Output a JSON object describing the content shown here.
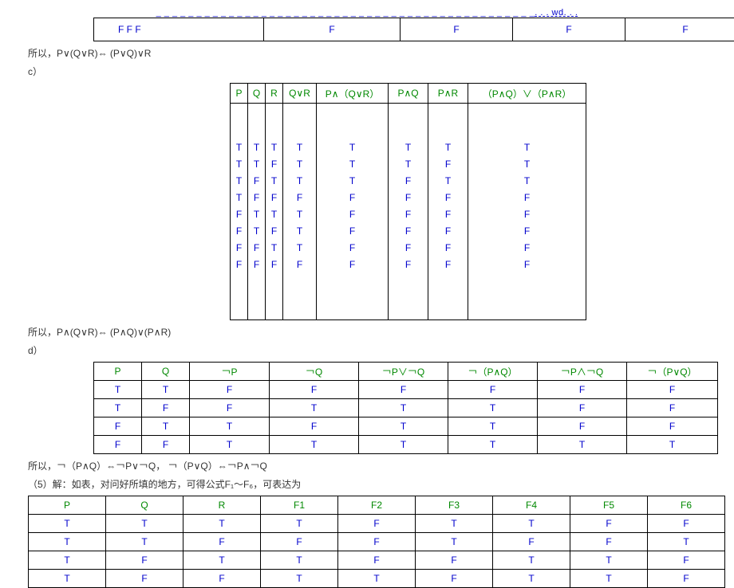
{
  "link": ". . . wd. . .",
  "dashes": "_ _ _ _ _ _ _ _ _ _ _ _ _ _ _ _ _ _ _ _ _ _ _ _ _ _ _ _ _ _ _ _ _ _ _ _ _ _ _ _ _ _ _ _ _ _ _",
  "t1": {
    "cells": [
      "F   F   F",
      "F",
      "F",
      "F",
      "F"
    ]
  },
  "cap1": "所以，P∨(Q∨R)⇔ (P∨Q)∨R",
  "cap1b": "  c）",
  "t2": {
    "headers": [
      "P",
      "Q",
      "R",
      "Q∨R",
      "P∧（Q∨R）",
      "P∧Q",
      "P∧R",
      "（P∧Q）∨（P∧R）"
    ],
    "rows": [
      [
        "T",
        "T",
        "T",
        "T",
        "T",
        "T",
        "T",
        "T"
      ],
      [
        "T",
        "T",
        "F",
        "T",
        "T",
        "T",
        "F",
        "T"
      ],
      [
        "T",
        "F",
        "T",
        "T",
        "T",
        "F",
        "T",
        "T"
      ],
      [
        "T",
        "F",
        "F",
        "F",
        "F",
        "F",
        "F",
        "F"
      ],
      [
        "F",
        "T",
        "T",
        "T",
        "F",
        "F",
        "F",
        "F"
      ],
      [
        "F",
        "T",
        "F",
        "T",
        "F",
        "F",
        "F",
        "F"
      ],
      [
        "F",
        "F",
        "T",
        "T",
        "F",
        "F",
        "F",
        "F"
      ],
      [
        "F",
        "F",
        "F",
        "F",
        "F",
        "F",
        "F",
        "F"
      ]
    ]
  },
  "cap2": "所以，P∧(Q∨R)⇔ (P∧Q)∨(P∧R)",
  "cap2b": "  d）",
  "t3": {
    "headers": [
      "P",
      "Q",
      "￢P",
      "￢Q",
      "￢P∨￢Q",
      "￢（P∧Q）",
      "￢P∧￢Q",
      "￢（P∨Q）"
    ],
    "rows": [
      [
        "T",
        "T",
        "F",
        "F",
        "F",
        "F",
        "F",
        "F"
      ],
      [
        "T",
        "F",
        "F",
        "T",
        "T",
        "T",
        "F",
        "F"
      ],
      [
        "F",
        "T",
        "T",
        "F",
        "T",
        "T",
        "F",
        "F"
      ],
      [
        "F",
        "F",
        "T",
        "T",
        "T",
        "T",
        "T",
        "T"
      ]
    ]
  },
  "cap3": "所以，￢（P∧Q）⇔￢P∨￢Q，  ￢（P∨Q）⇔￢P∧￢Q",
  "cap4": "（5）解：如表，对问好所填的地方，可得公式F₁～F₆，可表达为",
  "t4": {
    "headers": [
      "P",
      "Q",
      "R",
      "F1",
      "F2",
      "F3",
      "F4",
      "F5",
      "F6"
    ],
    "rows": [
      [
        "T",
        "T",
        "T",
        "T",
        "F",
        "T",
        "T",
        "F",
        "F"
      ],
      [
        "T",
        "T",
        "F",
        "F",
        "F",
        "T",
        "F",
        "F",
        "T"
      ],
      [
        "T",
        "F",
        "T",
        "T",
        "F",
        "F",
        "T",
        "T",
        "F"
      ],
      [
        "T",
        "F",
        "F",
        "T",
        "T",
        "F",
        "T",
        "T",
        "F"
      ]
    ]
  }
}
